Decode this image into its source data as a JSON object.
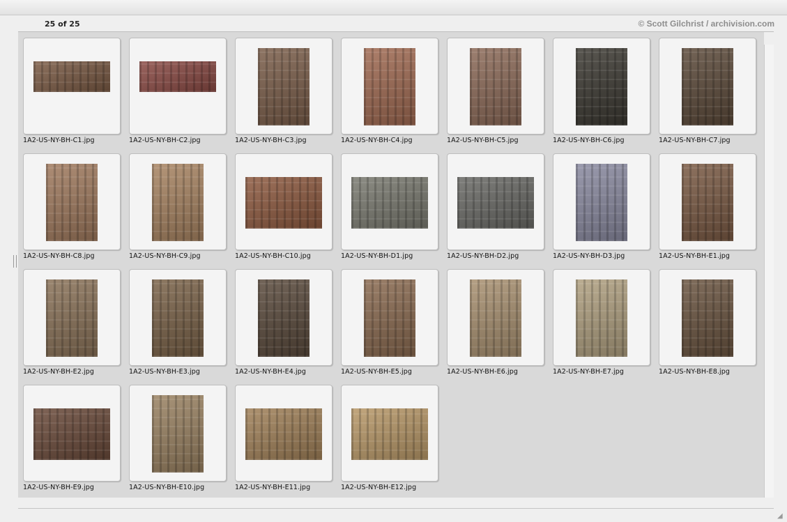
{
  "header": {
    "count_text": "25 of 25",
    "credit_text": "© Scott Gilchrist / archivision.com"
  },
  "thumbnails": [
    {
      "filename": "1A2-US-NY-BH-C1.jpg"
    },
    {
      "filename": "1A2-US-NY-BH-C2.jpg"
    },
    {
      "filename": "1A2-US-NY-BH-C3.jpg"
    },
    {
      "filename": "1A2-US-NY-BH-C4.jpg"
    },
    {
      "filename": "1A2-US-NY-BH-C5.jpg"
    },
    {
      "filename": "1A2-US-NY-BH-C6.jpg"
    },
    {
      "filename": "1A2-US-NY-BH-C7.jpg"
    },
    {
      "filename": "1A2-US-NY-BH-C8.jpg"
    },
    {
      "filename": "1A2-US-NY-BH-C9.jpg"
    },
    {
      "filename": "1A2-US-NY-BH-C10.jpg"
    },
    {
      "filename": "1A2-US-NY-BH-D1.jpg"
    },
    {
      "filename": "1A2-US-NY-BH-D2.jpg"
    },
    {
      "filename": "1A2-US-NY-BH-D3.jpg"
    },
    {
      "filename": "1A2-US-NY-BH-E1.jpg"
    },
    {
      "filename": "1A2-US-NY-BH-E2.jpg"
    },
    {
      "filename": "1A2-US-NY-BH-E3.jpg"
    },
    {
      "filename": "1A2-US-NY-BH-E4.jpg"
    },
    {
      "filename": "1A2-US-NY-BH-E5.jpg"
    },
    {
      "filename": "1A2-US-NY-BH-E6.jpg"
    },
    {
      "filename": "1A2-US-NY-BH-E7.jpg"
    },
    {
      "filename": "1A2-US-NY-BH-E8.jpg"
    },
    {
      "filename": "1A2-US-NY-BH-E9.jpg"
    },
    {
      "filename": "1A2-US-NY-BH-E10.jpg"
    },
    {
      "filename": "1A2-US-NY-BH-E11.jpg"
    },
    {
      "filename": "1A2-US-NY-BH-E12.jpg"
    }
  ]
}
